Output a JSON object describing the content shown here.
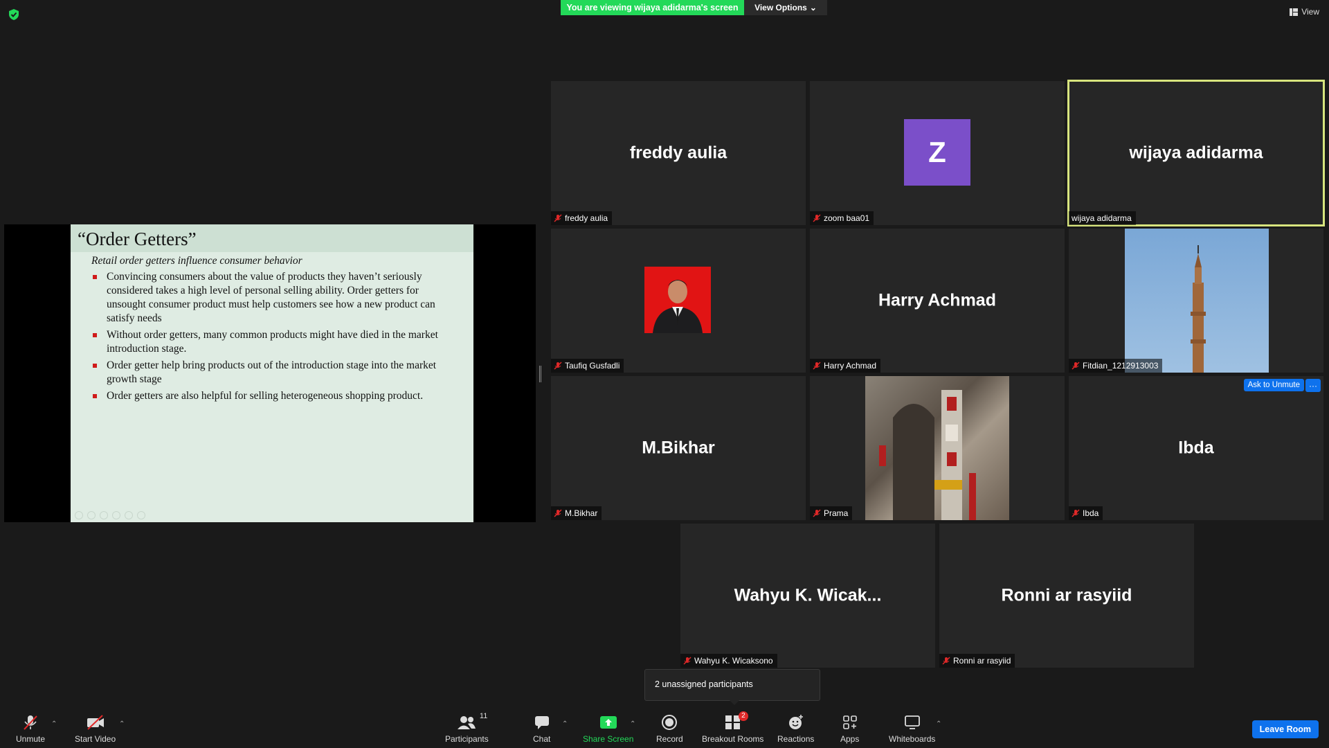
{
  "banner": {
    "viewing_text": "You are viewing wijaya adidarma's screen",
    "view_options_label": "View Options"
  },
  "top_right": {
    "view_label": "View"
  },
  "slide": {
    "title": "“Order Getters”",
    "subtitle": "Retail order getters  influence consumer behavior",
    "bullets": [
      "Convincing consumers about the value of products they haven’t seriously considered takes a high level of personal selling ability. Order getters for unsought consumer product must help customers see how a new product can satisfy needs",
      "Without order getters, many common products might have died in the market introduction stage.",
      "Order getter help bring products out of the introduction stage into the market growth stage",
      "Order getters are also helpful for selling heterogeneous shopping product."
    ]
  },
  "tiles": [
    {
      "big_name": "freddy aulia",
      "label": "freddy aulia"
    },
    {
      "avatar_letter": "Z",
      "label": "zoom baa01"
    },
    {
      "big_name": "wijaya adidarma",
      "label": "wijaya adidarma"
    },
    {
      "label": "Taufiq Gusfadli"
    },
    {
      "big_name": "Harry Achmad",
      "label": "Harry Achmad"
    },
    {
      "label": "Fitdian_1212913003"
    },
    {
      "big_name": "M.Bikhar",
      "label": "M.Bikhar"
    },
    {
      "label": "Prama"
    },
    {
      "big_name": "Ibda",
      "label": "Ibda",
      "ask_unmute": "Ask to Unmute",
      "more": "···"
    },
    {
      "big_name": "Wahyu  K.  Wicak...",
      "label": "Wahyu K. Wicaksono"
    },
    {
      "big_name": "Ronni ar rasyiid",
      "label": "Ronni ar rasyiid"
    }
  ],
  "tooltip": {
    "text": "2 unassigned participants"
  },
  "toolbar": {
    "unmute": "Unmute",
    "start_video": "Start Video",
    "participants": "Participants",
    "participants_count": "11",
    "chat": "Chat",
    "share_screen": "Share Screen",
    "record": "Record",
    "breakout_rooms": "Breakout Rooms",
    "breakout_badge": "2",
    "reactions": "Reactions",
    "apps": "Apps",
    "whiteboards": "Whiteboards",
    "leave_room": "Leave Room"
  },
  "colors": {
    "accent_blue": "#0e72ed",
    "banner_green": "#23d959",
    "active_speaker": "#d8e57e",
    "mic_muted_red": "#e02828"
  }
}
